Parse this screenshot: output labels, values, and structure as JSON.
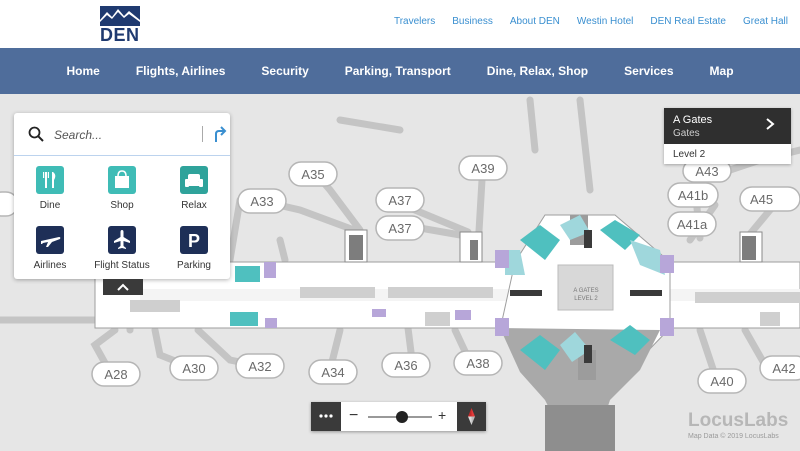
{
  "logo": {
    "text": "DEN"
  },
  "toplinks": [
    "Travelers",
    "Business",
    "About DEN",
    "Westin Hotel",
    "DEN Real Estate",
    "Great Hall"
  ],
  "nav": [
    "Home",
    "Flights, Airlines",
    "Security",
    "Parking, Transport",
    "Dine, Relax, Shop",
    "Services",
    "Map"
  ],
  "search": {
    "placeholder": "Search..."
  },
  "categories": [
    {
      "label": "Dine",
      "icon": "fork-knife-icon",
      "color": "#3fbcb6"
    },
    {
      "label": "Shop",
      "icon": "shopping-bag-icon",
      "color": "#3fbcb6"
    },
    {
      "label": "Relax",
      "icon": "armchair-icon",
      "color": "#2fa39b"
    },
    {
      "label": "Airlines",
      "icon": "airplane-icon",
      "color": "#1e2f57"
    },
    {
      "label": "Flight Status",
      "icon": "airplane-up-icon",
      "color": "#1e2f57"
    },
    {
      "label": "Parking",
      "icon": "parking-icon",
      "color": "#1e2f57"
    }
  ],
  "level_panel": {
    "title": "A Gates",
    "subtitle": "Gates",
    "level": "Level 2"
  },
  "gates": [
    "A35",
    "A39",
    "A33",
    "A37",
    "A37",
    "A41b",
    "A43",
    "A45",
    "A41a",
    "A28",
    "A30",
    "A32",
    "A34",
    "A36",
    "A38",
    "A40",
    "A42"
  ],
  "map_center_label": [
    "A GATES",
    "LEVEL 2"
  ],
  "brand": "LocusLabs",
  "map_data": "Map Data © 2019 LocusLabs",
  "colors": {
    "nav": "#4f6d9b",
    "accent": "#3a8fd0",
    "teal": "#3fbcb6",
    "navy": "#1e2f57"
  }
}
